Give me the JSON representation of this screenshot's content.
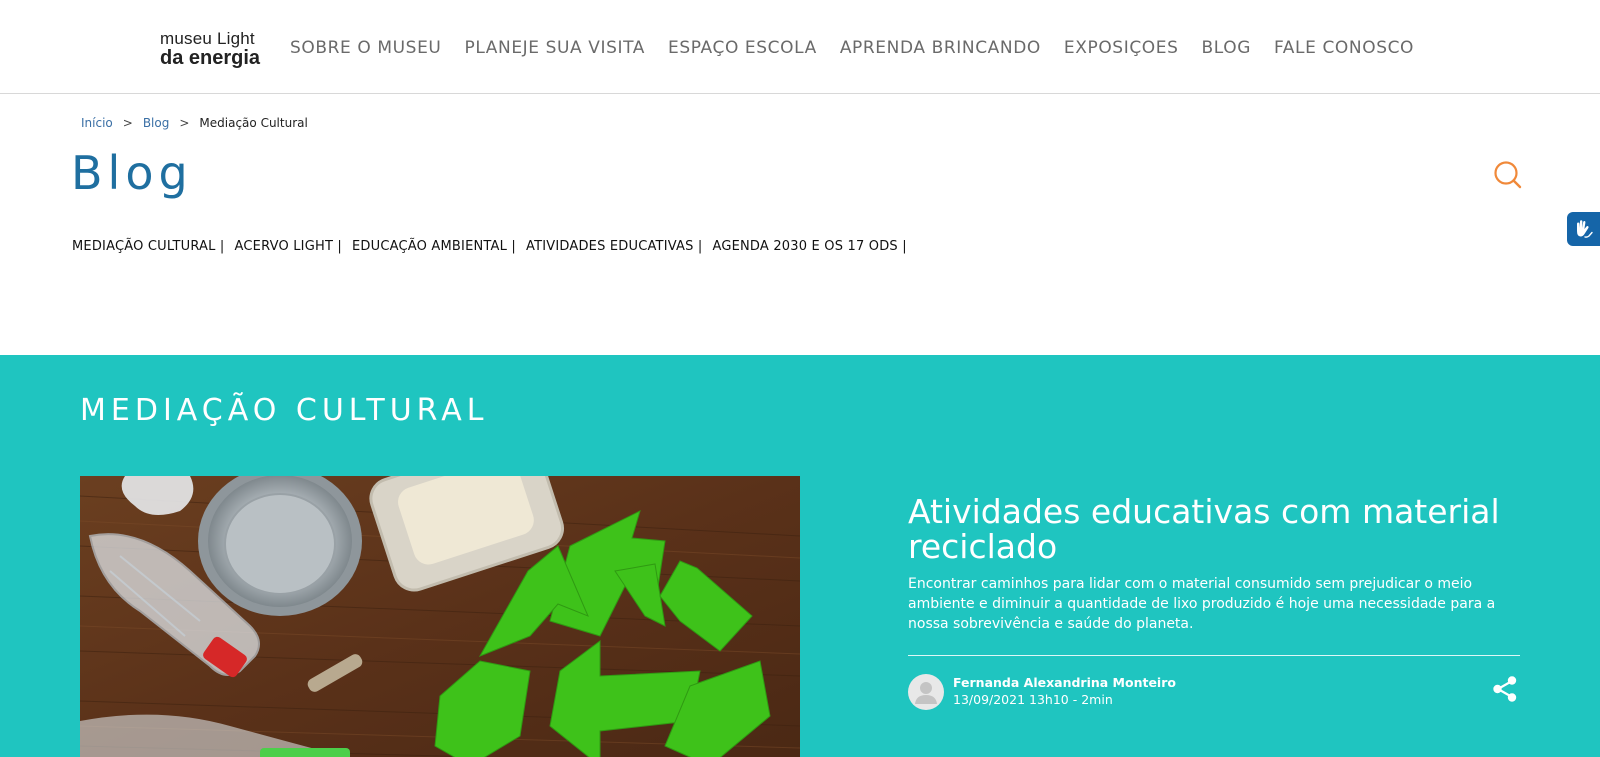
{
  "header": {
    "logo_line1": "museu Light",
    "logo_line2": "da energia",
    "nav": [
      {
        "label": "SOBRE O MUSEU"
      },
      {
        "label": "PLANEJE SUA VISITA"
      },
      {
        "label": "ESPAÇO ESCOLA"
      },
      {
        "label": "APRENDA BRINCANDO"
      },
      {
        "label": "EXPOSIÇOES"
      },
      {
        "label": "BLOG"
      },
      {
        "label": "FALE CONOSCO"
      }
    ]
  },
  "breadcrumb": {
    "items": [
      "Início",
      "Blog",
      "Mediação Cultural"
    ],
    "separator": ">"
  },
  "page": {
    "title": "Blog",
    "search_icon": "search-icon"
  },
  "categories": [
    "MEDIAÇÃO CULTURAL |",
    "ACERVO LIGHT |",
    "EDUCAÇÃO AMBIENTAL |",
    "ATIVIDADES EDUCATIVAS |",
    "AGENDA 2030 E OS 17 ODS |"
  ],
  "accessibility": {
    "icon": "sign-language-hands-icon"
  },
  "featured": {
    "section_title": "MEDIAÇÃO CULTURAL",
    "post": {
      "title": "Atividades educativas com material reciclado",
      "excerpt": "Encontrar caminhos para lidar com o material consumido sem prejudicar o meio ambiente e diminuir a quantidade de lixo produzido é hoje uma necessidade para a nossa sobrevivência e saúde do planeta.",
      "author": "Fernanda Alexandrina Monteiro",
      "meta": "13/09/2021 13h10 - 2min",
      "image_icon": "recycle-symbol-photo",
      "share_icon": "share-icon"
    }
  },
  "colors": {
    "teal": "#1fc5c0",
    "title_blue": "#1f6fa0",
    "search_orange": "#f0893a",
    "vlibras_blue": "#1565a8",
    "recycle_green": "#3ec21a"
  }
}
